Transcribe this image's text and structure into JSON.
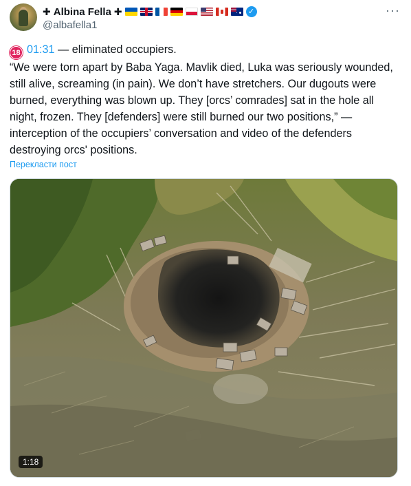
{
  "author": {
    "prefix_symbol": "✚",
    "name": "Albina Fella",
    "suffix_symbol": "✚",
    "flags": [
      "ukraine-flag-icon",
      "uk-flag-icon",
      "france-flag-icon",
      "germany-flag-icon",
      "poland-flag-icon",
      "usa-flag-icon",
      "canada-flag-icon",
      "australia-flag-icon"
    ],
    "verified_mark": "✓",
    "handle": "@albafella1"
  },
  "more_menu": "···",
  "tweet": {
    "badge": "18",
    "timestamp": "01:31",
    "headline": " — eliminated occupiers.",
    "body": "“We were torn apart by Baba Yaga. Mavlik died, Luka was seriously wounded, still alive, screaming (in pain). We don’t have stretchers. Our dugouts were burned, everything was blown up. They [orcs’ comrades] sat in the hole all night, frozen. They [defenders] were still burned our two positions,” — interception of the occupiers’ conversation and video of the defenders destroying orcs' positions."
  },
  "translate_link": "Перекласти пост",
  "video": {
    "duration": "1:18"
  },
  "colors": {
    "link": "#1d9bf0",
    "text": "#0f1419",
    "secondary": "#536471",
    "badge": "#e0245e"
  }
}
